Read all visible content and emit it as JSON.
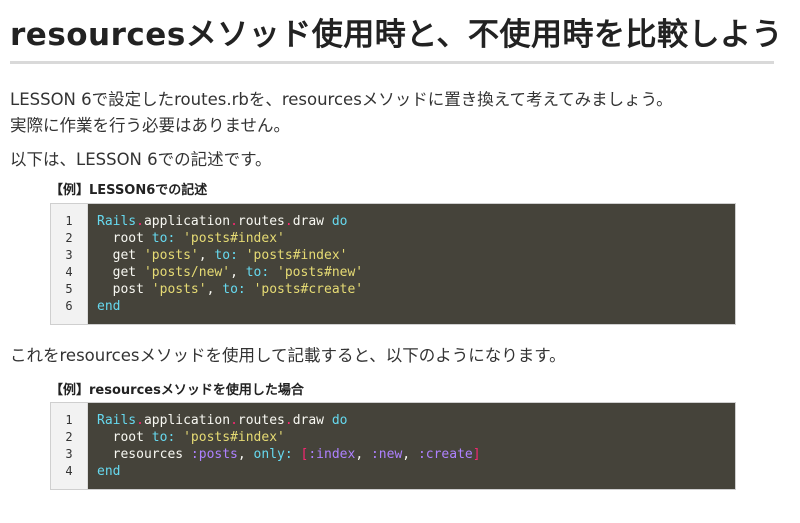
{
  "title": "resourcesメソッド使用時と、不使用時を比較しよう",
  "paragraphs": {
    "intro_line1": "LESSON 6で設定したroutes.rbを、resourcesメソッドに置き換えて考えてみましょう。",
    "intro_line2": "実際に作業を行う必要はありません。",
    "before_example1": "以下は、LESSON 6での記述です。",
    "before_example2": "これをresourcesメソッドを使用して記載すると、以下のようになります。"
  },
  "example1": {
    "label": "【例】LESSON6での記述",
    "lines": [
      {
        "no": "1",
        "tokens": [
          {
            "t": "Rails",
            "c": "const"
          },
          {
            "t": ".",
            "c": "dot"
          },
          {
            "t": "application",
            "c": "plain"
          },
          {
            "t": ".",
            "c": "dot"
          },
          {
            "t": "routes",
            "c": "plain"
          },
          {
            "t": ".",
            "c": "dot"
          },
          {
            "t": "draw ",
            "c": "plain"
          },
          {
            "t": "do",
            "c": "kw"
          }
        ]
      },
      {
        "no": "2",
        "tokens": [
          {
            "t": "  root ",
            "c": "plain"
          },
          {
            "t": "to:",
            "c": "kw"
          },
          {
            "t": " ",
            "c": "plain"
          },
          {
            "t": "'posts#index'",
            "c": "str"
          }
        ]
      },
      {
        "no": "3",
        "tokens": [
          {
            "t": "  get ",
            "c": "plain"
          },
          {
            "t": "'posts'",
            "c": "str"
          },
          {
            "t": ", ",
            "c": "plain"
          },
          {
            "t": "to:",
            "c": "kw"
          },
          {
            "t": " ",
            "c": "plain"
          },
          {
            "t": "'posts#index'",
            "c": "str"
          }
        ]
      },
      {
        "no": "4",
        "tokens": [
          {
            "t": "  get ",
            "c": "plain"
          },
          {
            "t": "'posts/new'",
            "c": "str"
          },
          {
            "t": ", ",
            "c": "plain"
          },
          {
            "t": "to:",
            "c": "kw"
          },
          {
            "t": " ",
            "c": "plain"
          },
          {
            "t": "'posts#new'",
            "c": "str"
          }
        ]
      },
      {
        "no": "5",
        "tokens": [
          {
            "t": "  post ",
            "c": "plain"
          },
          {
            "t": "'posts'",
            "c": "str"
          },
          {
            "t": ", ",
            "c": "plain"
          },
          {
            "t": "to:",
            "c": "kw"
          },
          {
            "t": " ",
            "c": "plain"
          },
          {
            "t": "'posts#create'",
            "c": "str"
          }
        ]
      },
      {
        "no": "6",
        "tokens": [
          {
            "t": "end",
            "c": "kw"
          }
        ]
      }
    ]
  },
  "example2": {
    "label": "【例】resourcesメソッドを使用した場合",
    "lines": [
      {
        "no": "1",
        "tokens": [
          {
            "t": "Rails",
            "c": "const"
          },
          {
            "t": ".",
            "c": "dot"
          },
          {
            "t": "application",
            "c": "plain"
          },
          {
            "t": ".",
            "c": "dot"
          },
          {
            "t": "routes",
            "c": "plain"
          },
          {
            "t": ".",
            "c": "dot"
          },
          {
            "t": "draw ",
            "c": "plain"
          },
          {
            "t": "do",
            "c": "kw"
          }
        ]
      },
      {
        "no": "2",
        "tokens": [
          {
            "t": "  root ",
            "c": "plain"
          },
          {
            "t": "to:",
            "c": "kw"
          },
          {
            "t": " ",
            "c": "plain"
          },
          {
            "t": "'posts#index'",
            "c": "str"
          }
        ]
      },
      {
        "no": "3",
        "tokens": [
          {
            "t": "  resources ",
            "c": "plain"
          },
          {
            "t": ":posts",
            "c": "sym"
          },
          {
            "t": ", ",
            "c": "plain"
          },
          {
            "t": "only:",
            "c": "kw"
          },
          {
            "t": " ",
            "c": "plain"
          },
          {
            "t": "[",
            "c": "brk"
          },
          {
            "t": ":index",
            "c": "sym"
          },
          {
            "t": ", ",
            "c": "plain"
          },
          {
            "t": ":new",
            "c": "sym"
          },
          {
            "t": ", ",
            "c": "plain"
          },
          {
            "t": ":create",
            "c": "sym"
          },
          {
            "t": "]",
            "c": "brk"
          }
        ]
      },
      {
        "no": "4",
        "tokens": [
          {
            "t": "end",
            "c": "kw"
          }
        ]
      }
    ]
  },
  "colors": {
    "code_background": "#45433a",
    "gutter_background": "#f2f2f2",
    "keyword": "#66d9ef",
    "string": "#e6db74",
    "symbol": "#ae81ff",
    "punctuation": "#f92672",
    "title_rule": "#d9d9d9"
  }
}
